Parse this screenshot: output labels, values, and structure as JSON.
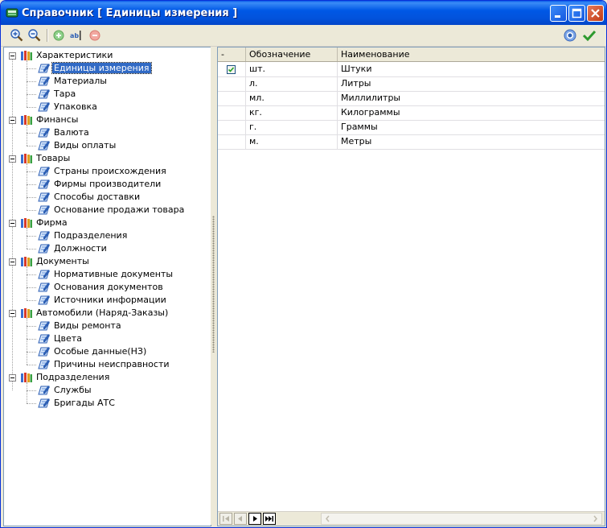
{
  "window": {
    "title": "Справочник [ Единицы измерения ]"
  },
  "icons": {
    "app": "book-icon",
    "toolbar": [
      "zoom-in-icon",
      "zoom-out-icon",
      "add-icon",
      "rename-icon",
      "delete-icon",
      "info-icon",
      "ok-check-icon"
    ],
    "folder": "books-icon",
    "item": "document-pencil-icon"
  },
  "colors": {
    "titlebar": "#0058e6",
    "selection": "#316ac5",
    "close_button": "#c23a14"
  },
  "tree": {
    "groups": [
      {
        "label": "Характеристики",
        "items": [
          "Единицы измерения",
          "Материалы",
          "Тара",
          "Упаковка"
        ]
      },
      {
        "label": "Финансы",
        "items": [
          "Валюта",
          "Виды оплаты"
        ]
      },
      {
        "label": "Товары",
        "items": [
          "Страны происхождения",
          "Фирмы производители",
          "Способы доставки",
          "Основание продажи товара"
        ]
      },
      {
        "label": "Фирма",
        "items": [
          "Подразделения",
          "Должности"
        ]
      },
      {
        "label": "Документы",
        "items": [
          "Нормативные документы",
          "Основания документов",
          "Источники информации"
        ]
      },
      {
        "label": "Автомобили (Наряд-Заказы)",
        "items": [
          "Виды ремонта",
          "Цвета",
          "Особые данные(НЗ)",
          "Причины неисправности"
        ]
      },
      {
        "label": "Подразделения",
        "items": [
          "Службы",
          "Бригады АТС"
        ]
      }
    ],
    "selected": "Единицы измерения"
  },
  "grid": {
    "columns": [
      "-",
      "Обозначение",
      "Наименование"
    ],
    "rows": [
      {
        "checked": true,
        "code": "шт.",
        "name": "Штуки"
      },
      {
        "checked": false,
        "code": "л.",
        "name": "Литры"
      },
      {
        "checked": false,
        "code": "мл.",
        "name": "Миллилитры"
      },
      {
        "checked": false,
        "code": "кг.",
        "name": "Килограммы"
      },
      {
        "checked": false,
        "code": "г.",
        "name": "Граммы"
      },
      {
        "checked": false,
        "code": "м.",
        "name": "Метры"
      }
    ]
  },
  "navigator": [
    "first-record-icon",
    "prev-record-icon",
    "next-record-icon",
    "last-record-icon"
  ]
}
